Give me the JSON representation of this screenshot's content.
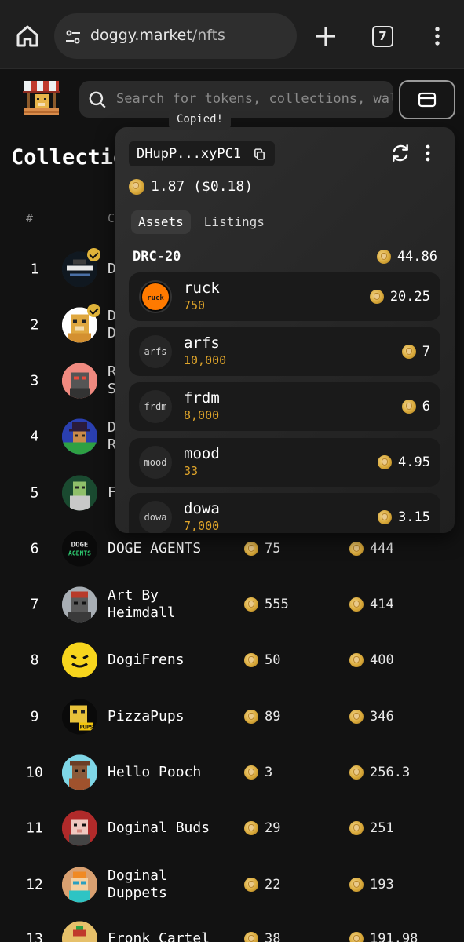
{
  "browser": {
    "url_domain": "doggy.market",
    "url_path": "/nfts",
    "tab_count": "7"
  },
  "site": {
    "search_placeholder": "Search for tokens, collections, wallets",
    "page_title": "Collections",
    "columns": {
      "rank": "#",
      "collection": "C"
    }
  },
  "collections": [
    {
      "rank": "1",
      "name": "D",
      "floor": "",
      "volume": ""
    },
    {
      "rank": "2",
      "name": "D\nD",
      "floor": "",
      "volume": ""
    },
    {
      "rank": "3",
      "name": "R\nS",
      "floor": "",
      "volume": ""
    },
    {
      "rank": "4",
      "name": "D\nR",
      "floor": "",
      "volume": ""
    },
    {
      "rank": "5",
      "name": "F",
      "floor": "",
      "volume": ""
    },
    {
      "rank": "6",
      "name": "DOGE AGENTS",
      "floor": "75",
      "volume": "444"
    },
    {
      "rank": "7",
      "name": "Art By\nHeimdall",
      "floor": "555",
      "volume": "414"
    },
    {
      "rank": "8",
      "name": "DogiFrens",
      "floor": "50",
      "volume": "400"
    },
    {
      "rank": "9",
      "name": "PizzaPups",
      "floor": "89",
      "volume": "346"
    },
    {
      "rank": "10",
      "name": "Hello Pooch",
      "floor": "3",
      "volume": "256.3"
    },
    {
      "rank": "11",
      "name": "Doginal Buds",
      "floor": "29",
      "volume": "251"
    },
    {
      "rank": "12",
      "name": "Doginal\nDuppets",
      "floor": "22",
      "volume": "193"
    },
    {
      "rank": "13",
      "name": "Fronk Cartel",
      "floor": "38",
      "volume": "191.98"
    }
  ],
  "wallet": {
    "tooltip": "Copied!",
    "address": "DHupP...xyPC1",
    "balance": "1.87 ($0.18)",
    "tabs": [
      "Assets",
      "Listings"
    ],
    "section_label": "DRC-20",
    "section_total": "44.86",
    "tokens": [
      {
        "icon": "ruck",
        "name": "ruck",
        "amount": "750",
        "value": "20.25"
      },
      {
        "icon": "arfs",
        "name": "arfs",
        "amount": "10,000",
        "value": "7"
      },
      {
        "icon": "frdm",
        "name": "frdm",
        "amount": "8,000",
        "value": "6"
      },
      {
        "icon": "mood",
        "name": "mood",
        "amount": "33",
        "value": "4.95"
      },
      {
        "icon": "dowa",
        "name": "dowa",
        "amount": "7,000",
        "value": "3.15"
      }
    ]
  },
  "colors": {
    "background": "#121212",
    "accent_gold": "#e0a52a",
    "badge": "#e0b43a"
  }
}
